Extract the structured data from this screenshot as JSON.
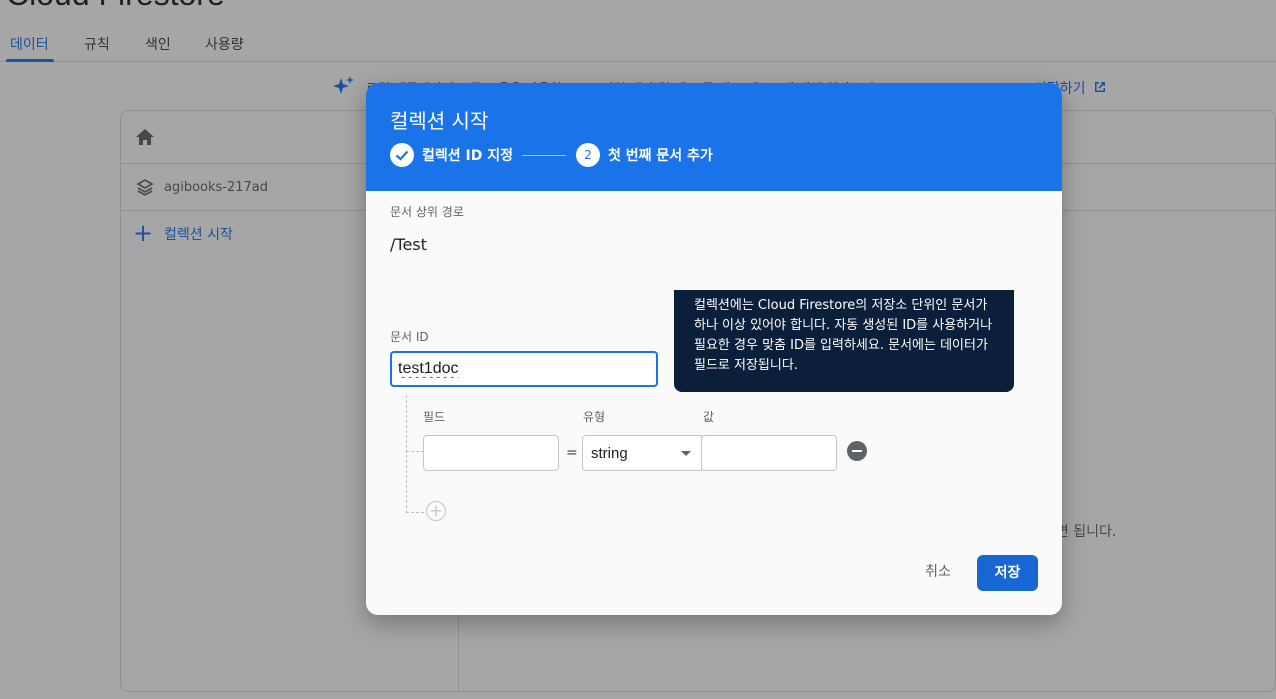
{
  "page": {
    "title": "Cloud Firestore",
    "tabs": [
      {
        "label": "데이터",
        "active": true
      },
      {
        "label": "규칙",
        "active": false
      },
      {
        "label": "색인",
        "active": false
      },
      {
        "label": "사용량",
        "active": false
      }
    ],
    "banner_text": "로컬 에뮬레이터 도구 모음을 사용한 프로토타입 제작 및 엔드 투 엔드 테스트에 대해 알아보기",
    "banner_link": "시작하기",
    "database_name": "agibooks-217ad",
    "add_collection": "컬렉션 시작",
    "hint_text": "하면 됩니다."
  },
  "dialog": {
    "title": "컬렉션 시작",
    "step1_label": "컬렉션 ID 지정",
    "step2_number": "2",
    "step2_label": "첫 번째 문서 추가",
    "parent_path_label": "문서 상위 경로",
    "parent_path": "/Test",
    "doc_id_label": "문서 ID",
    "doc_id_value": "test1doc",
    "tooltip_text": "컬렉션에는 Cloud Firestore의 저장소 단위인 문서가 하나 이상 있어야 합니다. 자동 생성된 ID를 사용하거나 필요한 경우 맞춤 ID를 입력하세요. 문서에는 데이터가 필드로 저장됩니다.",
    "field_label": "필드",
    "type_label": "유형",
    "value_label": "값",
    "equals": "=",
    "field_value": "",
    "type_value": "string",
    "value_value": "",
    "add_field": "+",
    "cancel_label": "취소",
    "save_label": "저장"
  },
  "colors": {
    "accent": "#1a73e8",
    "save_button": "#1967d2",
    "tooltip_bg": "#0b1f3a"
  }
}
